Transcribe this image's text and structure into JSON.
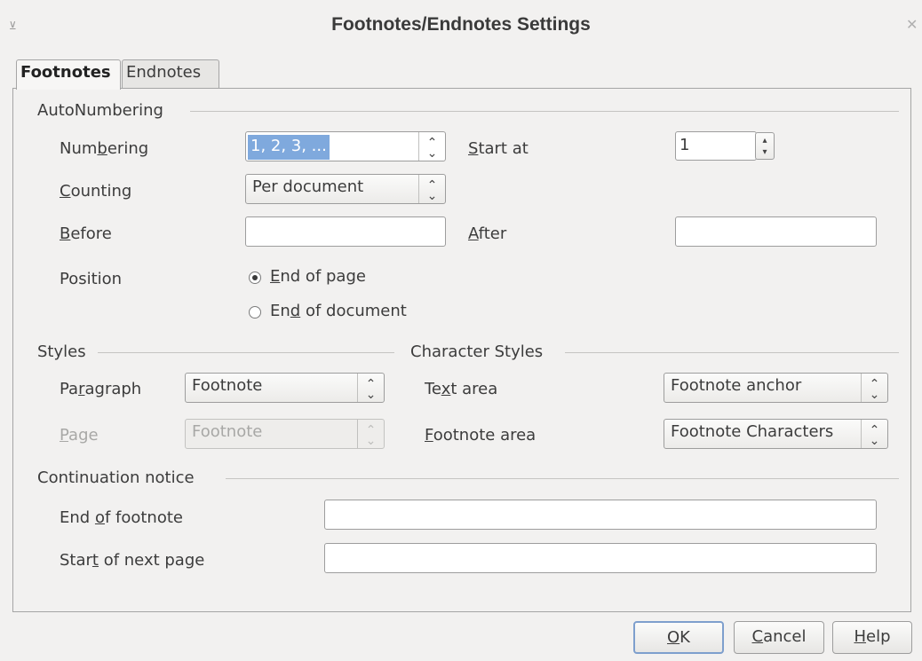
{
  "window": {
    "title": "Footnotes/Endnotes Settings",
    "menu_glyph": "⊻",
    "close_glyph": "✕"
  },
  "tabs": [
    {
      "label": "Footnotes",
      "active": true
    },
    {
      "label": "Endnotes",
      "active": false
    }
  ],
  "autonumbering": {
    "section_label": "AutoNumbering",
    "numbering": {
      "label_pre": "Num",
      "label_key": "b",
      "label_post": "ering",
      "value": "1, 2, 3, ..."
    },
    "start_at": {
      "label_pre": "",
      "label_key": "S",
      "label_post": "tart at",
      "value": "1"
    },
    "counting": {
      "label_pre": "",
      "label_key": "C",
      "label_post": "ounting",
      "value": "Per document"
    },
    "before": {
      "label_pre": "",
      "label_key": "B",
      "label_post": "efore",
      "value": ""
    },
    "after": {
      "label_pre": "",
      "label_key": "A",
      "label_post": "fter",
      "value": ""
    },
    "position": {
      "label": "Position",
      "end_of_page": {
        "label_pre": "",
        "label_key": "E",
        "label_post": "nd of page",
        "checked": true
      },
      "end_of_document": {
        "label_pre": "En",
        "label_key": "d",
        "label_post": " of document",
        "checked": false
      }
    }
  },
  "styles": {
    "section_label": "Styles",
    "paragraph": {
      "label_pre": "Pa",
      "label_key": "r",
      "label_post": "agraph",
      "value": "Footnote"
    },
    "page": {
      "label_pre": "",
      "label_key": "P",
      "label_post": "age",
      "value": "Footnote",
      "disabled": true
    }
  },
  "character_styles": {
    "section_label": "Character Styles",
    "text_area": {
      "label_pre": "Te",
      "label_key": "x",
      "label_post": "t area",
      "value": "Footnote anchor"
    },
    "footnote_area": {
      "label_pre": "",
      "label_key": "F",
      "label_post": "ootnote area",
      "value": "Footnote Characters"
    }
  },
  "continuation": {
    "section_label": "Continuation notice",
    "end_of_footnote": {
      "label_pre": "End ",
      "label_key": "o",
      "label_post": "f footnote",
      "value": ""
    },
    "start_of_next_page": {
      "label_pre": "Star",
      "label_key": "t",
      "label_post": " of next page",
      "value": ""
    }
  },
  "buttons": {
    "ok": {
      "label_key": "O",
      "label_post": "K"
    },
    "cancel": {
      "label_key": "C",
      "label_post": "ancel"
    },
    "help": {
      "label_key": "H",
      "label_post": "elp"
    }
  },
  "icons": {
    "spin_up": "▴",
    "spin_down": "▾",
    "combo_arrows": "⌃⌄"
  },
  "colors": {
    "selection": "#7fa9dd",
    "default_button_border": "#7e9fcd",
    "background": "#f2f1f0"
  }
}
